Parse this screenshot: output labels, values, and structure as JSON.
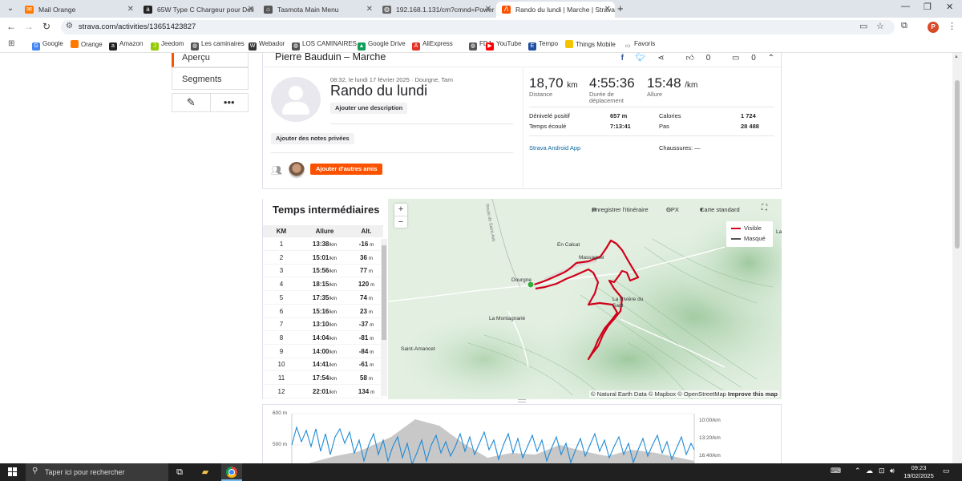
{
  "browser": {
    "tabs": [
      {
        "title": "Mail Orange",
        "icon": "mail-orange-icon",
        "color": "#ff7900",
        "glyph": "✉"
      },
      {
        "title": "65W Type C Chargeur pour Dell",
        "icon": "amazon-icon",
        "color": "#222222",
        "glyph": "a"
      },
      {
        "title": "Tasmota Main Menu",
        "icon": "tasmota-icon",
        "color": "#555555",
        "glyph": "⌂"
      },
      {
        "title": "192.168.1.131/cm?cmnd=Power",
        "icon": "globe-icon",
        "color": "#666666",
        "glyph": "◍"
      },
      {
        "title": "Rando du lundi | Marche | Strava",
        "icon": "strava-icon",
        "color": "#fc5200",
        "glyph": "Λ"
      }
    ],
    "url": "strava.com/activities/13651423827",
    "profile_initial": "P",
    "bookmarks": [
      {
        "label": "Google",
        "color": "#4285f4",
        "glyph": "G"
      },
      {
        "label": "Orange",
        "color": "#ff7900",
        "glyph": ""
      },
      {
        "label": "Amazon",
        "color": "#222222",
        "glyph": "a"
      },
      {
        "label": "Jeedom",
        "color": "#94ca02",
        "glyph": "J"
      },
      {
        "label": "Les caminaires",
        "color": "#555555",
        "glyph": "◍"
      },
      {
        "label": "Webador",
        "color": "#333333",
        "glyph": "W"
      },
      {
        "label": "LOS CAMINAIRES",
        "color": "#555555",
        "glyph": "◍"
      },
      {
        "label": "Google Drive",
        "color": "#0f9d58",
        "glyph": "▲"
      },
      {
        "label": "AliExpress",
        "color": "#e43225",
        "glyph": "A"
      },
      {
        "label": "FDJ",
        "color": "#555555",
        "glyph": "◍"
      },
      {
        "label": "YouTube",
        "color": "#ff0000",
        "glyph": "▶"
      },
      {
        "label": "Tempo",
        "color": "#1f4fa0",
        "glyph": "E"
      },
      {
        "label": "Things Mobile",
        "color": "#f5c400",
        "glyph": ""
      },
      {
        "label": "Favoris",
        "color": "#ffffff",
        "glyph": "▭"
      }
    ]
  },
  "sidenav": {
    "overview": "Aperçu",
    "segments": "Segments"
  },
  "activity": {
    "athlete_line": "Pierre Bauduin – Marche",
    "kudos": "0",
    "comments": "0",
    "date_line": "08:32, le lundi 17 février 2025 · Dourgne, Tarn",
    "title": "Rando du lundi",
    "add_description": "Ajouter une description",
    "add_private_notes": "Ajouter des notes privées",
    "add_friends": "Ajouter d'autres amis",
    "stats": {
      "distance_value": "18,70",
      "distance_unit": "km",
      "distance_label": "Distance",
      "moving_time_value": "4:55:36",
      "moving_time_label": "Durée de déplacement",
      "pace_value": "15:48",
      "pace_unit": "/km",
      "pace_label": "Allure",
      "elevation_label": "Dénivelé positif",
      "elevation_value": "657 m",
      "elapsed_label": "Temps écoulé",
      "elapsed_value": "7:13:41",
      "calories_label": "Calories",
      "calories_value": "1 724",
      "steps_label": "Pas",
      "steps_value": "28 488",
      "device": "Strava Android App",
      "shoes": "Chaussures: —"
    }
  },
  "splits": {
    "title": "Temps intermédiaires",
    "headers": {
      "km": "KM",
      "pace": "Allure",
      "alt": "Alt."
    },
    "pace_unit": "/km",
    "alt_unit": "m",
    "rows": [
      {
        "km": "1",
        "pace": "13:38",
        "alt": "-16"
      },
      {
        "km": "2",
        "pace": "15:01",
        "alt": "36"
      },
      {
        "km": "3",
        "pace": "15:56",
        "alt": "77"
      },
      {
        "km": "4",
        "pace": "18:15",
        "alt": "120"
      },
      {
        "km": "5",
        "pace": "17:35",
        "alt": "74"
      },
      {
        "km": "6",
        "pace": "15:16",
        "alt": "23"
      },
      {
        "km": "7",
        "pace": "13:10",
        "alt": "-37"
      },
      {
        "km": "8",
        "pace": "14:04",
        "alt": "-81"
      },
      {
        "km": "9",
        "pace": "14:00",
        "alt": "-84"
      },
      {
        "km": "10",
        "pace": "14:41",
        "alt": "-61"
      },
      {
        "km": "11",
        "pace": "17:54",
        "alt": "58"
      },
      {
        "km": "12",
        "pace": "22:01",
        "alt": "134"
      }
    ]
  },
  "map": {
    "zoom_in": "+",
    "zoom_out": "−",
    "save_route": "Enregistrer l'itinéraire",
    "gpx": "GPX",
    "map_style": "Carte standard",
    "legend_visible": "Visible",
    "legend_hidden": "Masqué",
    "attribution": "© Natural Earth Data © Mapbox © OpenStreetMap",
    "improve": "Improve this map",
    "towns": [
      "En Calcat",
      "Massaguel",
      "Dourgne",
      "La Rivière du Sant",
      "La Montagnarié",
      "Saint-Amancet",
      "Route de Saint-Avit",
      "La"
    ],
    "route_color": "#d0021b",
    "hidden_color": "#555555"
  },
  "elevation_chart": {
    "y_labels": [
      "600 m",
      "500 m"
    ],
    "pace_labels": [
      "10:00/km",
      "13:20/km",
      "16:40/km"
    ]
  },
  "taskbar": {
    "search_placeholder": "Taper ici pour rechercher",
    "time": "09:23",
    "date": "19/02/2025"
  }
}
